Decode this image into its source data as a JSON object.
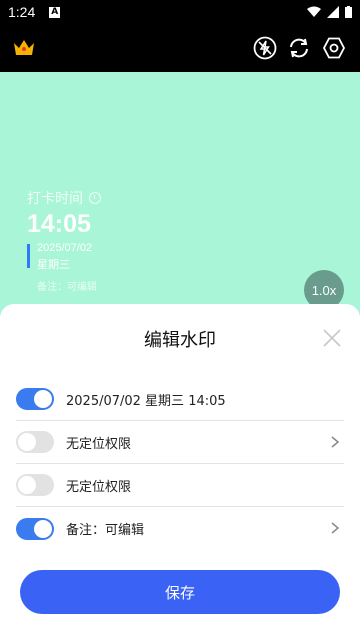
{
  "status_bar": {
    "time": "1:24",
    "notification_icon": "A"
  },
  "toolbar": {
    "icons": [
      "crown-icon",
      "flash-off-icon",
      "switch-camera-icon",
      "settings-icon"
    ],
    "crown_color": "#f7b200"
  },
  "watermark": {
    "title": "打卡时间",
    "time": "14:05",
    "date": "2025/07/02",
    "weekday": "星期三",
    "note": "备注：可编辑",
    "accent_color": "#2f7bf5"
  },
  "zoom": {
    "label": "1.0x"
  },
  "sheet": {
    "title": "编辑水印",
    "rows": [
      {
        "label": "2025/07/02 星期三 14:05",
        "enabled": true,
        "has_chevron": false
      },
      {
        "label": "无定位权限",
        "enabled": false,
        "has_chevron": true
      },
      {
        "label": "无定位权限",
        "enabled": false,
        "has_chevron": false
      },
      {
        "label": "备注：可编辑",
        "enabled": true,
        "has_chevron": true
      }
    ],
    "save_label": "保存",
    "toggle_on_color": "#3a7bf0",
    "save_color": "#3a63f5"
  }
}
